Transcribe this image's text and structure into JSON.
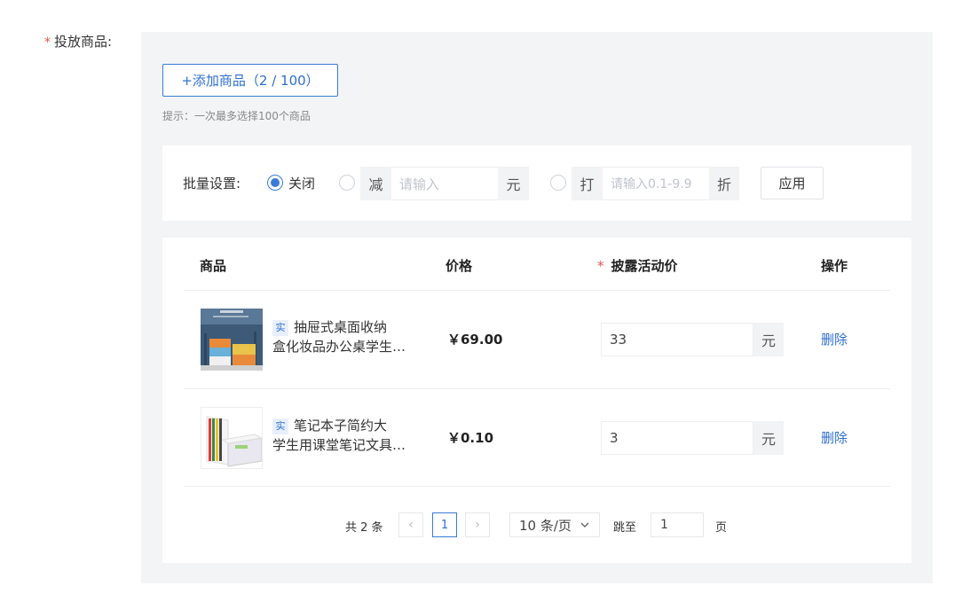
{
  "field": {
    "required_mark": "*",
    "label": "投放商品:"
  },
  "add_button": {
    "label": "+添加商品（2 / 100）"
  },
  "hint": "提示：一次最多选择100个商品",
  "batch": {
    "label": "批量设置:",
    "option_off": "关闭",
    "option_reduce_prefix": "减",
    "option_reduce_placeholder": "请输入",
    "option_reduce_suffix": "元",
    "option_discount_prefix": "打",
    "option_discount_placeholder": "请输入0.1-9.9",
    "option_discount_suffix": "折",
    "selected": "关闭",
    "apply_label": "应用"
  },
  "table": {
    "headers": {
      "product": "商品",
      "price": "价格",
      "activity_price": "披露活动价",
      "actions": "操作",
      "required_mark": "*"
    },
    "rows": [
      {
        "tag": "实",
        "title_line1": "抽屉式桌面收纳",
        "title_line2": "盒化妆品办公桌学生…",
        "price": "￥69.00",
        "activity_price": "33",
        "unit": "元",
        "delete": "删除"
      },
      {
        "tag": "实",
        "title_line1": "笔记本子简约大",
        "title_line2": "学生用课堂笔记文具…",
        "price": "￥0.10",
        "activity_price": "3",
        "unit": "元",
        "delete": "删除"
      }
    ]
  },
  "pagination": {
    "total": "共 2 条",
    "prev_icon": "‹",
    "current_page": "1",
    "next_icon": "›",
    "page_size": "10 条/页",
    "jump_label": "跳至",
    "jump_value": "1",
    "page_suffix": "页"
  },
  "colors": {
    "accent": "#2f6fd0",
    "required": "#e5534b",
    "panel_bg": "#f3f4f6"
  }
}
